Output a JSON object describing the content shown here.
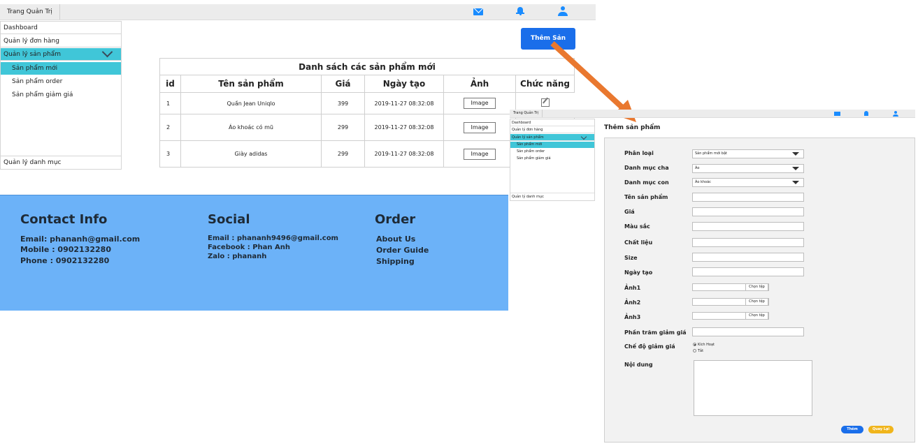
{
  "main": {
    "topbar": {
      "title": "Trang Quản Trị"
    },
    "sidebar": {
      "dashboard": "Dashboard",
      "orders": "Quản lý đơn hàng",
      "products": "Quản lý sản phẩm",
      "sub_new": "Sản phẩm mới",
      "sub_order": "Sản phẩm order",
      "sub_sale": "Sản phẩm giảm giá",
      "categories": "Quản lý danh mục"
    },
    "add_button": "Thêm Sản Phẩm",
    "table": {
      "caption": "Danh sách các sản phẩm mới",
      "headers": [
        "id",
        "Tên sản phẩm",
        "Giá",
        "Ngày tạo",
        "Ảnh",
        "Chức năng"
      ],
      "rows": [
        {
          "id": "1",
          "name": "Quần Jean Uniqlo",
          "price": "399",
          "date": "2019-11-27 08:32:08",
          "image": "Image"
        },
        {
          "id": "2",
          "name": "Áo khoác có mũ",
          "price": "299",
          "date": "2019-11-27 08:32:08",
          "image": "Image"
        },
        {
          "id": "3",
          "name": "Giày adidas",
          "price": "299",
          "date": "2019-11-27 08:32:08",
          "image": "Image"
        }
      ]
    },
    "footer": {
      "contact": {
        "heading": "Contact Info",
        "email": "Email: phananh@gmail.com",
        "mobile": "Mobile : 0902132280",
        "phone": "Phone : 0902132280"
      },
      "social": {
        "heading": "Social",
        "email": "Email : phananh9496@gmail.com",
        "facebook": "Facebook : Phan Anh",
        "zalo": "Zalo : phananh"
      },
      "order": {
        "heading": "Order",
        "about": "About Us",
        "guide": "Order Guide",
        "shipping": "Shipping"
      }
    }
  },
  "detail": {
    "topbar": {
      "title": "Trang Quản Trị"
    },
    "sidebar": {
      "dashboard": "Dashboard",
      "orders": "Quản lý đơn hàng",
      "products": "Quản lý sản phẩm",
      "sub_new": "Sản phẩm mới",
      "sub_order": "Sản phẩm order",
      "sub_sale": "Sản phẩm giảm giá",
      "categories": "Quản lý danh mục"
    },
    "form": {
      "title": "Thêm sản phẩm",
      "type_label": "Phân loại",
      "type_value": "Sản phẩm mới bật",
      "parent_label": "Danh mục cha",
      "parent_value": "Áo",
      "child_label": "Danh mục con",
      "child_value": "Áo khoác",
      "name_label": "Tên sản phẩm",
      "price_label": "Giá",
      "color_label": "Màu sắc",
      "material_label": "Chất liệu",
      "size_label": "Size",
      "date_label": "Ngày tạo",
      "image1_label": "Ảnh1",
      "image2_label": "Ảnh2",
      "image3_label": "Ảnh3",
      "choose_file": "Chọn tệp",
      "discount_label": "Phần trăm giảm giá",
      "discount_mode_label": "Chế độ giảm giá",
      "radio_active": "Kích Hoạt",
      "radio_off": "Tắt",
      "content_label": "Nội dung",
      "submit": "Thêm",
      "back": "Quay Lại"
    }
  },
  "colors": {
    "accent_blue": "#1a6eea",
    "active_item": "#40c6d8",
    "footer_bg": "#6cb2f8",
    "arrow": "#e9782f",
    "back_button": "#f0b51c"
  },
  "icons": [
    "mail-icon",
    "bell-icon",
    "user-icon",
    "chevron-down-icon",
    "edit-icon",
    "image-placeholder-icon"
  ]
}
